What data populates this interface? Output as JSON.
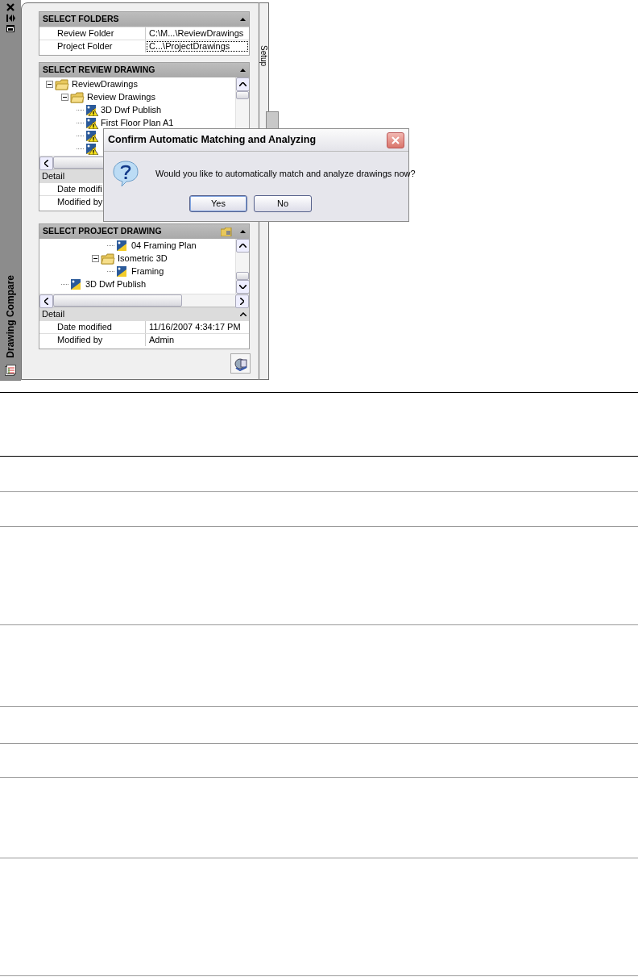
{
  "palette": {
    "title": "Drawing Compare",
    "tab": "Setup",
    "folders": {
      "title": "SELECT FOLDERS",
      "rows": [
        {
          "label": "Review Folder",
          "value": "C:\\M...\\ReviewDrawings",
          "selected": false
        },
        {
          "label": "Project Folder",
          "value": "C...\\ProjectDrawings",
          "selected": true
        }
      ]
    },
    "review": {
      "title": "SELECT REVIEW DRAWING",
      "tree": [
        {
          "label": "ReviewDrawings",
          "kind": "folder",
          "expanded": true,
          "children": [
            {
              "label": "Review Drawings",
              "kind": "folder",
              "expanded": true,
              "children": [
                {
                  "label": "3D Dwf Publish",
                  "kind": "drawing",
                  "warning": true
                },
                {
                  "label": "First Floor Plan A1",
                  "kind": "drawing",
                  "warning": true
                },
                {
                  "kind": "drawing",
                  "warning": true
                },
                {
                  "kind": "drawing",
                  "warning": true
                }
              ]
            }
          ]
        }
      ],
      "detail": {
        "title": "Detail",
        "rows": [
          {
            "label": "Date modifi"
          },
          {
            "label": "Modified by"
          }
        ]
      }
    },
    "project": {
      "title": "SELECT PROJECT DRAWING",
      "tree": [
        {
          "children": [
            {
              "children": [
                {
                  "children": [
                    {
                      "children": [
                        {
                          "label": "04 Framing Plan",
                          "kind": "drawing",
                          "warning": false
                        }
                      ]
                    },
                    {
                      "label": "Isometric 3D",
                      "kind": "folder",
                      "expanded": true,
                      "children": [
                        {
                          "label": "Framing",
                          "kind": "drawing",
                          "warning": false
                        }
                      ]
                    }
                  ]
                }
              ]
            },
            {
              "label": "3D Dwf Publish",
              "kind": "drawing",
              "warning": false
            }
          ]
        }
      ],
      "detail": {
        "title": "Detail",
        "expanded": true,
        "rows": [
          {
            "label": "Date modified",
            "value": "11/16/2007 4:34:17 PM"
          },
          {
            "label": "Modified by",
            "value": "Admin"
          }
        ]
      }
    }
  },
  "dialog": {
    "title": "Confirm Automatic Matching and Analyzing",
    "message": "Would you like to automatically match and analyze drawings now?",
    "buttons": [
      {
        "label": "Yes",
        "selected": true
      },
      {
        "label": "No",
        "selected": false
      }
    ]
  }
}
